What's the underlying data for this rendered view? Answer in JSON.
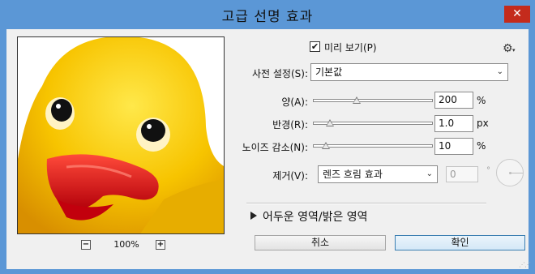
{
  "window": {
    "title": "고급 선명 효과",
    "close_label": "✕"
  },
  "preview": {
    "zoom_minus": "−",
    "zoom_level": "100%",
    "zoom_plus": "+"
  },
  "preview_checkbox": {
    "checked": true,
    "check_glyph": "✔",
    "label": "미리 보기(P)"
  },
  "settings": {
    "gear_glyph": "⚙",
    "caret_glyph": "▾"
  },
  "preset": {
    "label": "사전 설정(S):",
    "value": "기본값"
  },
  "amount": {
    "label": "양(A):",
    "value": "200",
    "unit": "%",
    "slider_fraction": 0.36
  },
  "radius": {
    "label": "반경(R):",
    "value": "1.0",
    "unit": "px",
    "slider_fraction": 0.14
  },
  "noise": {
    "label": "노이즈 감소(N):",
    "value": "10",
    "unit": "%",
    "slider_fraction": 0.1
  },
  "remove": {
    "label": "제거(V):",
    "value": "렌즈 흐림 효과",
    "angle_value": "0",
    "degree": "°"
  },
  "shadows_highlights": {
    "label": "어두운 영역/밝은 영역"
  },
  "buttons": {
    "cancel": "취소",
    "ok": "확인"
  },
  "arrow_glyph": "⌄",
  "colors": {
    "accent": "#5b97d6",
    "close": "#c42b1c"
  }
}
